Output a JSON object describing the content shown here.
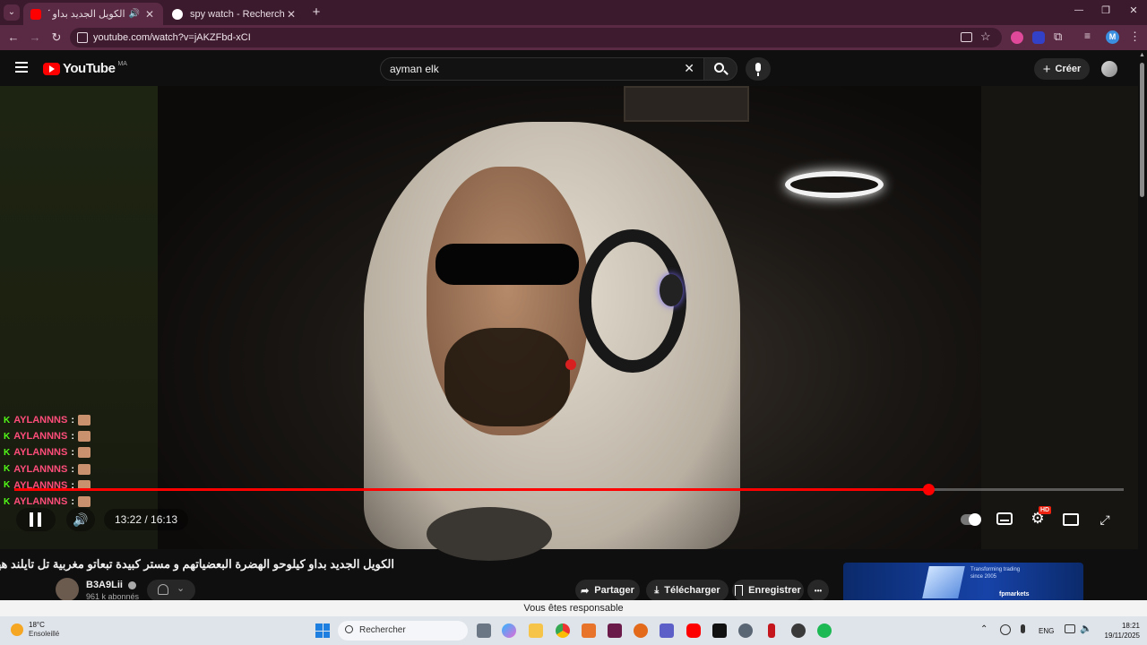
{
  "browser": {
    "tabs": [
      {
        "title": "الكويل الجديد بداو كيلوحو الهـ",
        "active": true
      },
      {
        "title": "spy watch - Recherche Google",
        "active": false
      }
    ],
    "new_tab": "+",
    "url": "youtube.com/watch?v=jAKZFbd-xCI",
    "window_controls": {
      "minimize": "—",
      "restore": "❐",
      "close": "✕"
    },
    "profile_initial": "M"
  },
  "youtube": {
    "logo_text": "YouTube",
    "region_code": "MA",
    "search_value": "ayman elk",
    "create_label": "Créer"
  },
  "player": {
    "chat_lines": [
      {
        "user": "AYLANNNS",
        "sep": ":"
      },
      {
        "user": "AYLANNNS",
        "sep": ":"
      },
      {
        "user": "AYLANNNS",
        "sep": ":"
      },
      {
        "user": "AYLANNNS",
        "sep": ":"
      },
      {
        "user": "AYLANNNS",
        "sep": ":"
      },
      {
        "user": "AYLANNNS",
        "sep": ":"
      }
    ],
    "time_display": "13:22 / 16:13",
    "progress_fraction": 0.8243,
    "hd_badge": "HD"
  },
  "video": {
    "title": "الكويل الجديد بداو كيلوحو الهضرة البعضياتهم و مستر كبيدة تبعاتو مغربية تل تايلند ههه",
    "channel": "B3A9Lii",
    "subscribers": "961 k abonnés",
    "actions": {
      "share": "Partager",
      "download": "Télécharger",
      "save": "Enregistrer",
      "more": "•••"
    }
  },
  "ad": {
    "tagline": "Transforming trading",
    "since": "since 2005",
    "brand": "fpmarkets"
  },
  "notice": "Vous êtes responsable",
  "taskbar": {
    "weather_temp": "18°C",
    "weather_desc": "Ensoleillé",
    "search_placeholder": "Rechercher",
    "language": "ENG",
    "time": "18:21",
    "date": "19/11/2025"
  },
  "colors": {
    "accent_red": "#ff0000",
    "chat_user": "#ff4d7a",
    "kick_green": "#53fc18",
    "tab_bar": "#3c1a2e"
  }
}
